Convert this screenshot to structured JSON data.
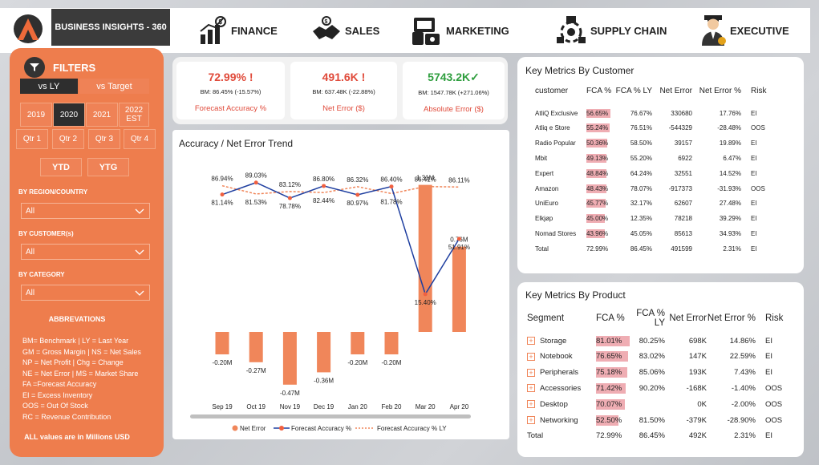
{
  "app": {
    "title": "BUSINESS INSIGHTS - 360"
  },
  "nav": [
    {
      "label": "FINANCE",
      "icon": "finance-chart-icon"
    },
    {
      "label": "SALES",
      "icon": "handshake-icon"
    },
    {
      "label": "MARKETING",
      "icon": "marketing-devices-icon"
    },
    {
      "label": "SUPPLY CHAIN",
      "icon": "supply-chain-icon"
    },
    {
      "label": "EXECUTIVE",
      "icon": "executive-person-icon"
    }
  ],
  "filters": {
    "title": "FILTERS",
    "compare": [
      "vs LY",
      "vs Target"
    ],
    "years": [
      "2019",
      "2020",
      "2021",
      "2022\nEST"
    ],
    "quarters": [
      "Qtr 1",
      "Qtr 2",
      "Qtr 3",
      "Qtr 4"
    ],
    "period": [
      "YTD",
      "YTG"
    ],
    "region_label": "BY REGION/COUNTRY",
    "region_value": "All",
    "customer_label": "BY CUSTOMER(s)",
    "customer_value": "All",
    "category_label": "BY CATEGORY",
    "category_value": "All",
    "abbr_title": "ABBREVATIONS",
    "abbr": [
      "BM= Benchmark | LY = Last Year",
      "GM =  Gross Margin | NS = Net Sales",
      "NP = Net Profit | Chg = Change",
      "NE = Net Error | MS = Market Share",
      "FA =Forecast Accuracy",
      "EI = Excess Inventory",
      "OOS = Out Of Stock",
      "RC = Revenue Contribution"
    ],
    "footer": "ALL values are in Millions USD"
  },
  "kpis": [
    {
      "value": "72.99% !",
      "bm": "BM: 86.45% (-15.57%)",
      "title": "Forecast Accuracy %",
      "color": "#e04a3a"
    },
    {
      "value": "491.6K !",
      "bm": "BM: 637.48K (-22.88%)",
      "title": "Net Error ($)",
      "color": "#e04a3a"
    },
    {
      "value": "5743.2K✓",
      "bm": "BM: 1547.78K (+271.06%)",
      "title": "Absolute Error ($)",
      "color": "#2e9e3e"
    }
  ],
  "trend": {
    "title": "Accuracy / Net Error Trend",
    "legend": [
      "Net Error",
      "Forecast Accuracy %",
      "Forecast Accuracy % LY"
    ]
  },
  "chart_data": {
    "type": "bar",
    "categories": [
      "Sep 19",
      "Oct 19",
      "Nov 19",
      "Dec 19",
      "Jan 20",
      "Feb 20",
      "Mar 20",
      "Apr 20"
    ],
    "series": [
      {
        "name": "Net Error",
        "values": [
          -0.2,
          -0.27,
          -0.47,
          -0.36,
          -0.2,
          -0.2,
          1.31,
          0.76
        ],
        "labels": [
          "-0.20M",
          "-0.27M",
          "-0.47M",
          "-0.36M",
          "-0.20M",
          "-0.20M",
          "1.31M",
          "0.76M"
        ]
      },
      {
        "name": "Forecast Accuracy %",
        "values": [
          81.14,
          89.03,
          78.78,
          86.8,
          80.97,
          86.4,
          15.4,
          51.91
        ],
        "labels": [
          "81.14%",
          "89.03%",
          "78.78%",
          "86.80%",
          "80.97%",
          "86.40%",
          "15.40%",
          "51.91%"
        ]
      },
      {
        "name": "Forecast Accuracy % LY",
        "values": [
          86.94,
          81.53,
          83.12,
          82.44,
          86.32,
          81.78,
          86.41,
          86.11
        ],
        "labels": [
          "86.94%",
          "81.53%",
          "83.12%",
          "82.44%",
          "86.32%",
          "81.78%",
          "86.41%",
          "86.11%"
        ]
      }
    ],
    "colors": {
      "bar": "#f0865a",
      "line": "#1f3fa0",
      "ly": "#f0865a",
      "marker": "#f06040"
    }
  },
  "customer_table": {
    "title": "Key Metrics By Customer",
    "headers": [
      "customer",
      "FCA %",
      "FCA % LY",
      "Net Error",
      "Net Error %",
      "Risk"
    ],
    "rows": [
      [
        "AtliQ Exclusive",
        "56.65%",
        "76.67%",
        "330680",
        "17.76%",
        "EI"
      ],
      [
        "Atliq e Store",
        "55.24%",
        "76.51%",
        "-544329",
        "-28.48%",
        "OOS"
      ],
      [
        "Radio Popular",
        "50.36%",
        "58.50%",
        "39157",
        "19.89%",
        "EI"
      ],
      [
        "Mbit",
        "49.13%",
        "55.20%",
        "6922",
        "6.47%",
        "EI"
      ],
      [
        "Expert",
        "48.84%",
        "64.24%",
        "32551",
        "14.52%",
        "EI"
      ],
      [
        "Amazon",
        "48.43%",
        "78.07%",
        "-917373",
        "-31.93%",
        "OOS"
      ],
      [
        "UniEuro",
        "45.77%",
        "32.17%",
        "62607",
        "27.48%",
        "EI"
      ],
      [
        "Elkjøp",
        "45.00%",
        "12.35%",
        "78218",
        "39.29%",
        "EI"
      ],
      [
        "Nomad Stores",
        "43.96%",
        "45.05%",
        "85613",
        "34.93%",
        "EI"
      ]
    ],
    "total": [
      "Total",
      "72.99%",
      "86.45%",
      "491599",
      "2.31%",
      "EI"
    ],
    "fca_fill": [
      0.57,
      0.55,
      0.5,
      0.49,
      0.49,
      0.48,
      0.46,
      0.45,
      0.44
    ]
  },
  "product_table": {
    "title": "Key Metrics By Product",
    "headers": [
      "Segment",
      "FCA %",
      "FCA % LY",
      "Net Error",
      "Net Error %",
      "Risk"
    ],
    "rows": [
      [
        "Storage",
        "81.01%",
        "80.25%",
        "698K",
        "14.86%",
        "EI"
      ],
      [
        "Notebook",
        "76.65%",
        "83.02%",
        "147K",
        "22.59%",
        "EI"
      ],
      [
        "Peripherals",
        "75.18%",
        "85.06%",
        "193K",
        "7.43%",
        "EI"
      ],
      [
        "Accessories",
        "71.42%",
        "90.20%",
        "-168K",
        "-1.40%",
        "OOS"
      ],
      [
        "Desktop",
        "70.07%",
        "",
        "0K",
        "-2.00%",
        "OOS"
      ],
      [
        "Networking",
        "52.50%",
        "81.50%",
        "-379K",
        "-28.90%",
        "OOS"
      ]
    ],
    "total": [
      "Total",
      "72.99%",
      "86.45%",
      "492K",
      "2.31%",
      "EI"
    ],
    "fca_fill": [
      0.81,
      0.77,
      0.75,
      0.71,
      0.7,
      0.53
    ]
  }
}
